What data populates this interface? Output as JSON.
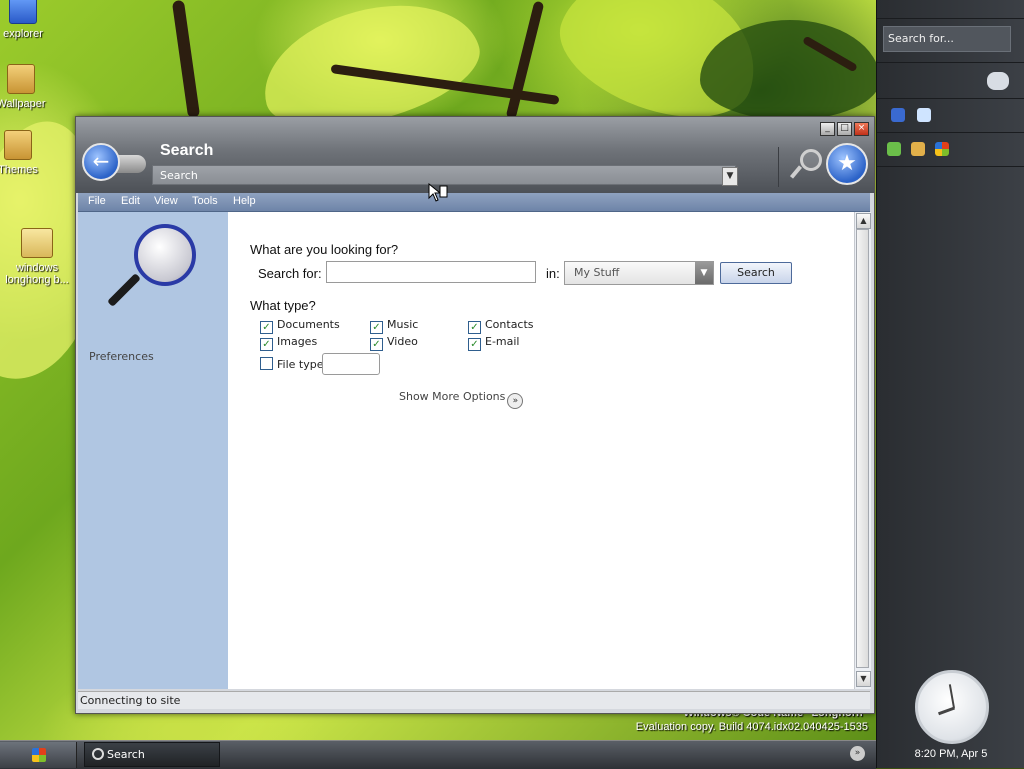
{
  "desktop": {
    "icons": [
      {
        "label": "explorer"
      },
      {
        "label": "Wallpaper"
      },
      {
        "label": "Themes"
      },
      {
        "label": "windows longhong b..."
      }
    ],
    "watermark_line1": "Windows® Code Name \"Longhorn\"",
    "watermark_line2": "Evaluation copy. Build 4074.idx02.040425-1535"
  },
  "window": {
    "title": "Search",
    "address": "Search",
    "controls": {
      "minimize": "_",
      "maximize": "□",
      "close": "×"
    },
    "menus": [
      "File",
      "Edit",
      "View",
      "Tools",
      "Help"
    ],
    "side_link": "Preferences",
    "heading": "What are you looking for?",
    "search_for_label": "Search for:",
    "search_value": "",
    "in_label": "in:",
    "scope_value": "My Stuff",
    "search_button": "Search",
    "type_heading": "What type?",
    "types": [
      {
        "label": "Documents",
        "checked": true
      },
      {
        "label": "Music",
        "checked": true
      },
      {
        "label": "Contacts",
        "checked": true
      },
      {
        "label": "Images",
        "checked": true
      },
      {
        "label": "Video",
        "checked": true
      },
      {
        "label": "E-mail",
        "checked": true
      }
    ],
    "file_type_label": "File type:",
    "file_type_checked": false,
    "file_type_value": "",
    "more_options": "Show More Options",
    "status": "Connecting to site"
  },
  "sidebar": {
    "search_placeholder": "Search for...",
    "clock_time": "8:20 PM, Apr 5"
  },
  "taskbar": {
    "task_label": "Search"
  },
  "colors": {
    "menubar": "#6e84a8",
    "sidepane": "#b0c6e2",
    "accent_blue": "#2c63c8"
  }
}
